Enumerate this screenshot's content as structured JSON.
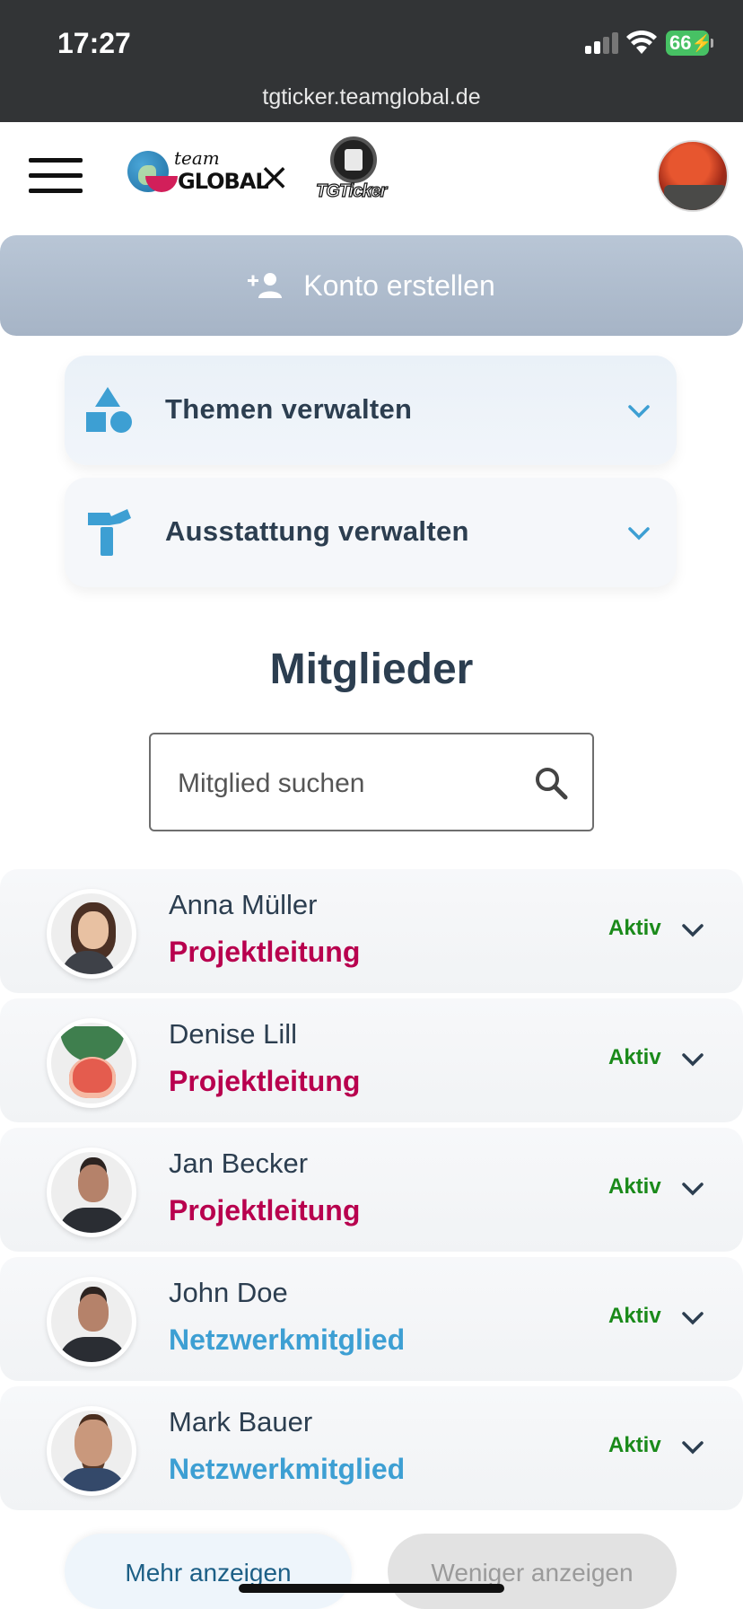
{
  "status_bar": {
    "time": "17:27",
    "battery": "66",
    "url": "tgticker.teamglobal.de"
  },
  "header": {
    "logo_team": "team",
    "logo_global": "GLOBAL",
    "separator": "×",
    "logo_ticker": "TGTicker"
  },
  "create_account": {
    "label": "Konto erstellen"
  },
  "accordions": [
    {
      "label": "Themen verwalten",
      "icon": "shapes-icon"
    },
    {
      "label": "Ausstattung verwalten",
      "icon": "hammer-icon"
    }
  ],
  "members_section": {
    "title": "Mitglieder",
    "search_placeholder": "Mitglied suchen"
  },
  "members": [
    {
      "name": "Anna Müller",
      "role": "Projektleitung",
      "status": "Aktiv"
    },
    {
      "name": "Denise Lill",
      "role": "Projektleitung",
      "status": "Aktiv"
    },
    {
      "name": "Jan Becker",
      "role": "Projektleitung",
      "status": "Aktiv"
    },
    {
      "name": "John Doe",
      "role": "Netzwerkmitglied",
      "status": "Aktiv"
    },
    {
      "name": "Mark Bauer",
      "role": "Netzwerkmitglied",
      "status": "Aktiv"
    }
  ],
  "buttons": {
    "more": "Mehr anzeigen",
    "less": "Weniger anzeigen"
  },
  "colors": {
    "accent_blue": "#3d9fd3",
    "lead_role": "#b8004e",
    "status_active": "#1a8a1a",
    "heading": "#2c3e50"
  }
}
